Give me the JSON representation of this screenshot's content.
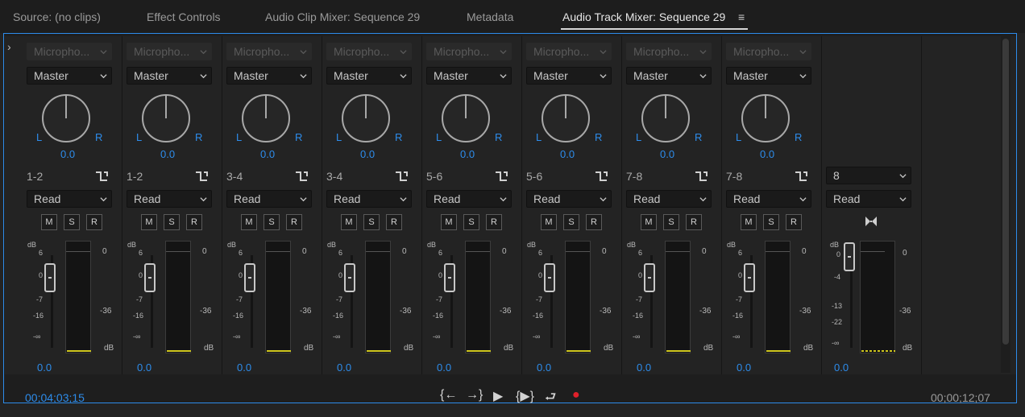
{
  "tabs": [
    {
      "label": "Source: (no clips)"
    },
    {
      "label": "Effect Controls"
    },
    {
      "label": "Audio Clip Mixer: Sequence 29"
    },
    {
      "label": "Metadata"
    },
    {
      "label": "Audio Track Mixer: Sequence 29",
      "active": true
    }
  ],
  "tab_menu_icon": "≡",
  "expand_icon": "›",
  "channels": [
    {
      "input": "Micropho...",
      "output": "Master",
      "pan": "0.0",
      "label": "1-2",
      "automation": "Read",
      "volume": "0.0"
    },
    {
      "input": "Micropho...",
      "output": "Master",
      "pan": "0.0",
      "label": "1-2",
      "automation": "Read",
      "volume": "0.0"
    },
    {
      "input": "Micropho...",
      "output": "Master",
      "pan": "0.0",
      "label": "3-4",
      "automation": "Read",
      "volume": "0.0"
    },
    {
      "input": "Micropho...",
      "output": "Master",
      "pan": "0.0",
      "label": "3-4",
      "automation": "Read",
      "volume": "0.0"
    },
    {
      "input": "Micropho...",
      "output": "Master",
      "pan": "0.0",
      "label": "5-6",
      "automation": "Read",
      "volume": "0.0"
    },
    {
      "input": "Micropho...",
      "output": "Master",
      "pan": "0.0",
      "label": "5-6",
      "automation": "Read",
      "volume": "0.0"
    },
    {
      "input": "Micropho...",
      "output": "Master",
      "pan": "0.0",
      "label": "7-8",
      "automation": "Read",
      "volume": "0.0"
    },
    {
      "input": "Micropho...",
      "output": "Master",
      "pan": "0.0",
      "label": "7-8",
      "automation": "Read",
      "volume": "0.0"
    }
  ],
  "pan_labels": {
    "left": "L",
    "right": "R"
  },
  "msr": {
    "mute": "M",
    "solo": "S",
    "record": "R"
  },
  "fader_scale": {
    "db": "dB",
    "t6": "6",
    "t0": "0",
    "tm7": "-7",
    "tm16": "-16",
    "tinf": "-∞"
  },
  "meter_scale": {
    "t0": "0",
    "tm36": "-36",
    "db": "dB"
  },
  "master": {
    "output": "8",
    "automation": "Read",
    "volume": "0.0",
    "fader_scale": {
      "db": "dB",
      "t0": "0",
      "tm4": "-4",
      "tm13": "-13",
      "tm22": "-22",
      "tinf": "-∞"
    }
  },
  "timecode_left": "00;04;03;15",
  "timecode_right": "00;00;12;07",
  "transport": {
    "goto_in": "{←",
    "goto_out": "→}",
    "play": "▶",
    "play_in_out": "{▶}",
    "loop": "⮐",
    "record": "●"
  },
  "colors": {
    "accent": "#2d8ceb",
    "record": "#e0202a",
    "peak": "#cfc71f"
  }
}
